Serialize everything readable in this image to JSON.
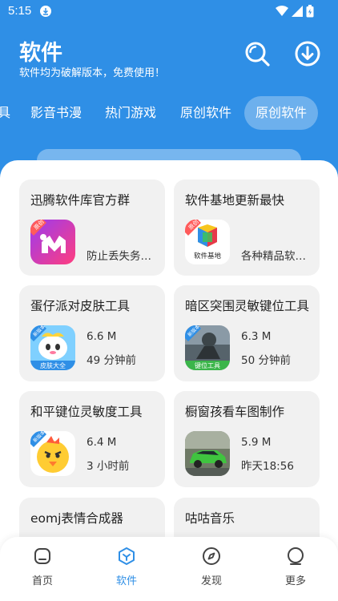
{
  "status_bar": {
    "time": "5:15"
  },
  "header": {
    "title": "软件",
    "subtitle": "软件均为破解版本，免费使用！"
  },
  "tabs": [
    {
      "label": "具"
    },
    {
      "label": "影音书漫"
    },
    {
      "label": "热门游戏"
    },
    {
      "label": "原创软件"
    },
    {
      "label": "原创软件",
      "active": true
    }
  ],
  "cards": [
    {
      "title": "迅腾软件库官方群",
      "desc": "防止丢失务必加入",
      "icon": "app-icon-pink-m",
      "badge": "原创"
    },
    {
      "title": "软件基地更新最快",
      "desc": "各种精品软件等你来",
      "icon": "app-icon-software-base",
      "badge": "原创",
      "icon_caption": "软件基地"
    },
    {
      "title": "蛋仔派对皮肤工具",
      "size": "6.6 M",
      "time": "49 分钟前",
      "icon": "app-icon-eggy",
      "badge": "新版本",
      "icon_caption": "皮肤大全"
    },
    {
      "title": "暗区突围灵敏键位工具",
      "size": "6.3 M",
      "time": "50 分钟前",
      "icon": "app-icon-battle",
      "badge": "新版本",
      "icon_caption": "键位工具"
    },
    {
      "title": "和平键位灵敏度工具",
      "size": "6.4 M",
      "time": "3 小时前",
      "icon": "app-icon-chick",
      "badge": "新版本"
    },
    {
      "title": "橱窗孩看车图制作",
      "size": "5.9 M",
      "time": "昨天18:56",
      "icon": "app-icon-car"
    },
    {
      "title": "eomj表情合成器"
    },
    {
      "title": "咕咕音乐"
    }
  ],
  "bottom_nav": [
    {
      "label": "首页",
      "icon": "home-icon"
    },
    {
      "label": "软件",
      "icon": "cube-icon",
      "active": true
    },
    {
      "label": "发现",
      "icon": "compass-icon"
    },
    {
      "label": "更多",
      "icon": "more-icon"
    }
  ],
  "colors": {
    "accent": "#2f8fe6",
    "card_bg": "#f1f1f1"
  }
}
